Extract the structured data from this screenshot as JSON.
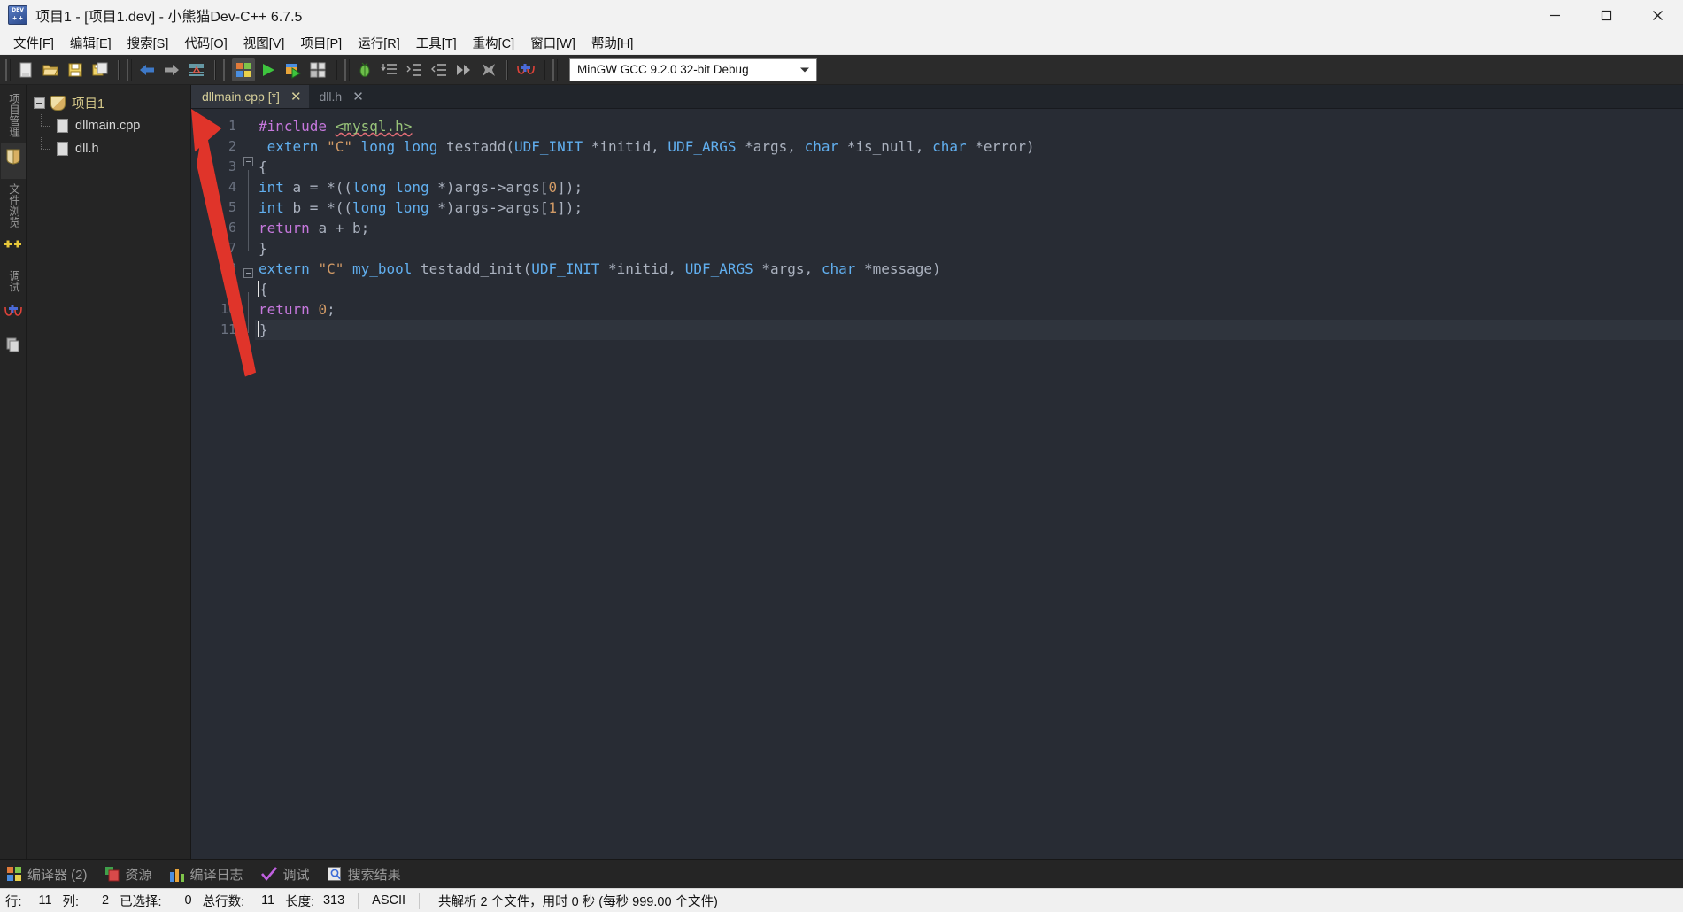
{
  "window": {
    "title": "项目1 - [项目1.dev] - 小熊猫Dev-C++ 6.7.5",
    "app_icon": "dev-cpp-icon",
    "minimize": "—",
    "maximize": "□",
    "close": "✕"
  },
  "menubar": {
    "items": [
      {
        "label": "文件[F]",
        "name": "menu-file"
      },
      {
        "label": "编辑[E]",
        "name": "menu-edit"
      },
      {
        "label": "搜索[S]",
        "name": "menu-search"
      },
      {
        "label": "代码[O]",
        "name": "menu-code"
      },
      {
        "label": "视图[V]",
        "name": "menu-view"
      },
      {
        "label": "项目[P]",
        "name": "menu-project"
      },
      {
        "label": "运行[R]",
        "name": "menu-run"
      },
      {
        "label": "工具[T]",
        "name": "menu-tools"
      },
      {
        "label": "重构[C]",
        "name": "menu-refactor"
      },
      {
        "label": "窗口[W]",
        "name": "menu-window"
      },
      {
        "label": "帮助[H]",
        "name": "menu-help"
      }
    ]
  },
  "toolbar": {
    "buttons": [
      {
        "name": "new-file-button",
        "icon": "new-file-icon"
      },
      {
        "name": "open-file-button",
        "icon": "open-folder-icon"
      },
      {
        "name": "save-button",
        "icon": "save-disk-icon"
      },
      {
        "name": "save-all-button",
        "icon": "save-all-icon"
      },
      {
        "name": "back-button",
        "icon": "arrow-left-icon"
      },
      {
        "name": "forward-button",
        "icon": "arrow-right-icon"
      },
      {
        "name": "find-replace-button",
        "icon": "find-replace-icon"
      },
      {
        "name": "compile-button",
        "icon": "compile-icon"
      },
      {
        "name": "run-button",
        "icon": "run-play-icon"
      },
      {
        "name": "compile-run-button",
        "icon": "compile-run-icon"
      },
      {
        "name": "rebuild-button",
        "icon": "rebuild-icon"
      },
      {
        "name": "debug-button",
        "icon": "debug-bug-icon"
      },
      {
        "name": "step-over-button",
        "icon": "step-over-icon"
      },
      {
        "name": "step-into-button",
        "icon": "step-into-icon"
      },
      {
        "name": "step-out-button",
        "icon": "step-out-icon"
      },
      {
        "name": "continue-button",
        "icon": "continue-fastforward-icon"
      },
      {
        "name": "stop-execution-button",
        "icon": "stop-x-icon"
      },
      {
        "name": "add-watch-button",
        "icon": "glasses-watch-icon"
      }
    ],
    "compiler_set": {
      "value": "MinGW GCC 9.2.0 32-bit Debug",
      "name": "compiler-set-select"
    }
  },
  "left_tabs": [
    {
      "label": "项目管理",
      "name": "vtab-project",
      "icon": "project-icon",
      "selected": true
    },
    {
      "label": "文件浏览",
      "name": "vtab-files",
      "icon": "files-icon",
      "selected": false
    },
    {
      "label": "类浏览",
      "name": "vtab-classes",
      "icon": "class-plus-icon",
      "selected": false
    },
    {
      "label": "调试",
      "name": "vtab-debug",
      "icon": "debug-glasses-icon",
      "selected": false
    },
    {
      "label": "书签",
      "name": "vtab-bookmarks",
      "icon": "bookmark-icon",
      "selected": false
    }
  ],
  "project_tree": {
    "root": {
      "label": "项目1",
      "name": "tree-node-project",
      "expanded": true
    },
    "children": [
      {
        "label": "dllmain.cpp",
        "name": "tree-node-dllmain-cpp"
      },
      {
        "label": "dll.h",
        "name": "tree-node-dll-h"
      }
    ]
  },
  "editor_tabs": [
    {
      "label": "dllmain.cpp [*]",
      "name": "editor-tab-dllmain-cpp",
      "selected": true,
      "close": "✕"
    },
    {
      "label": "dll.h",
      "name": "editor-tab-dll-h",
      "selected": false,
      "close": "✕"
    }
  ],
  "editor": {
    "line_numbers": [
      "1",
      "2",
      "3",
      "4",
      "5",
      "6",
      "7",
      "8",
      "9",
      "10",
      "11"
    ],
    "breakpoint_line": 1,
    "current_line": 11,
    "lines": [
      {
        "n": "1",
        "segments": [
          {
            "t": "#include ",
            "c": "kw"
          },
          {
            "t": "<mysql.h>",
            "c": "inc err-underline"
          }
        ]
      },
      {
        "n": "2",
        "segments": [
          {
            "t": " ",
            "c": "punct"
          },
          {
            "t": "extern ",
            "c": "kw2"
          },
          {
            "t": "\"C\"",
            "c": "str"
          },
          {
            "t": " ",
            "c": "punct"
          },
          {
            "t": "long long ",
            "c": "kw2"
          },
          {
            "t": "testadd(",
            "c": "ident"
          },
          {
            "t": "UDF_INIT ",
            "c": "kw2"
          },
          {
            "t": "*initid, ",
            "c": "ident"
          },
          {
            "t": "UDF_ARGS ",
            "c": "kw2"
          },
          {
            "t": "*args, ",
            "c": "ident"
          },
          {
            "t": "char ",
            "c": "kw2"
          },
          {
            "t": "*is_null, ",
            "c": "ident"
          },
          {
            "t": "char ",
            "c": "kw2"
          },
          {
            "t": "*error)",
            "c": "ident"
          }
        ]
      },
      {
        "n": "3",
        "segments": [
          {
            "t": "{",
            "c": "punct"
          }
        ]
      },
      {
        "n": "4",
        "segments": [
          {
            "t": "int ",
            "c": "kw2"
          },
          {
            "t": "a = *((",
            "c": "ident"
          },
          {
            "t": "long long ",
            "c": "kw2"
          },
          {
            "t": "*)args->args[",
            "c": "ident"
          },
          {
            "t": "0",
            "c": "num"
          },
          {
            "t": "]);",
            "c": "ident"
          }
        ]
      },
      {
        "n": "5",
        "segments": [
          {
            "t": "int ",
            "c": "kw2"
          },
          {
            "t": "b = *((",
            "c": "ident"
          },
          {
            "t": "long long ",
            "c": "kw2"
          },
          {
            "t": "*)args->args[",
            "c": "ident"
          },
          {
            "t": "1",
            "c": "num"
          },
          {
            "t": "]);",
            "c": "ident"
          }
        ]
      },
      {
        "n": "6",
        "segments": [
          {
            "t": "return ",
            "c": "kw"
          },
          {
            "t": "a + b;",
            "c": "ident"
          }
        ]
      },
      {
        "n": "7",
        "segments": [
          {
            "t": "}",
            "c": "punct"
          }
        ]
      },
      {
        "n": "8",
        "segments": [
          {
            "t": "extern ",
            "c": "kw2"
          },
          {
            "t": "\"C\"",
            "c": "str"
          },
          {
            "t": " ",
            "c": "punct"
          },
          {
            "t": "my_bool ",
            "c": "kw2"
          },
          {
            "t": "testadd_init(",
            "c": "ident"
          },
          {
            "t": "UDF_INIT ",
            "c": "kw2"
          },
          {
            "t": "*initid, ",
            "c": "ident"
          },
          {
            "t": "UDF_ARGS ",
            "c": "kw2"
          },
          {
            "t": "*args, ",
            "c": "ident"
          },
          {
            "t": "char ",
            "c": "kw2"
          },
          {
            "t": "*message)",
            "c": "ident"
          }
        ]
      },
      {
        "n": "9",
        "segments": [
          {
            "t": "{",
            "c": "punct"
          }
        ]
      },
      {
        "n": "10",
        "segments": [
          {
            "t": "return ",
            "c": "kw"
          },
          {
            "t": "0",
            "c": "num"
          },
          {
            "t": ";",
            "c": "ident"
          }
        ]
      },
      {
        "n": "11",
        "segments": [
          {
            "t": "}",
            "c": "punct"
          }
        ]
      }
    ]
  },
  "bottom_tabs": [
    {
      "label": "编译器 (2)",
      "name": "bottom-tab-compiler",
      "icon": "compiler-icon"
    },
    {
      "label": "资源",
      "name": "bottom-tab-resources",
      "icon": "resources-icon"
    },
    {
      "label": "编译日志",
      "name": "bottom-tab-compile-log",
      "icon": "compile-log-icon"
    },
    {
      "label": "调试",
      "name": "bottom-tab-debug",
      "icon": "check-icon"
    },
    {
      "label": "搜索结果",
      "name": "bottom-tab-search-results",
      "icon": "search-results-icon"
    }
  ],
  "statusbar": {
    "row_label": "行:",
    "row_value": "11",
    "col_label": "列:",
    "col_value": "2",
    "sel_label": "已选择:",
    "sel_value": "0",
    "lines_label": "总行数:",
    "lines_value": "11",
    "len_label": "长度:",
    "len_value": "313",
    "encoding": "ASCII",
    "message": "共解析 2 个文件，用时 0 秒 (每秒 999.00 个文件)"
  },
  "colors": {
    "titlebar_bg": "#f2f2f2",
    "toolbar_bg": "#2b2b2b",
    "editor_bg": "#282c34",
    "panel_bg": "#252525",
    "accent_red": "#e04030",
    "keyword_purple": "#c678dd",
    "type_blue": "#61afef",
    "string_orange": "#d19a66",
    "include_green": "#98c379"
  }
}
